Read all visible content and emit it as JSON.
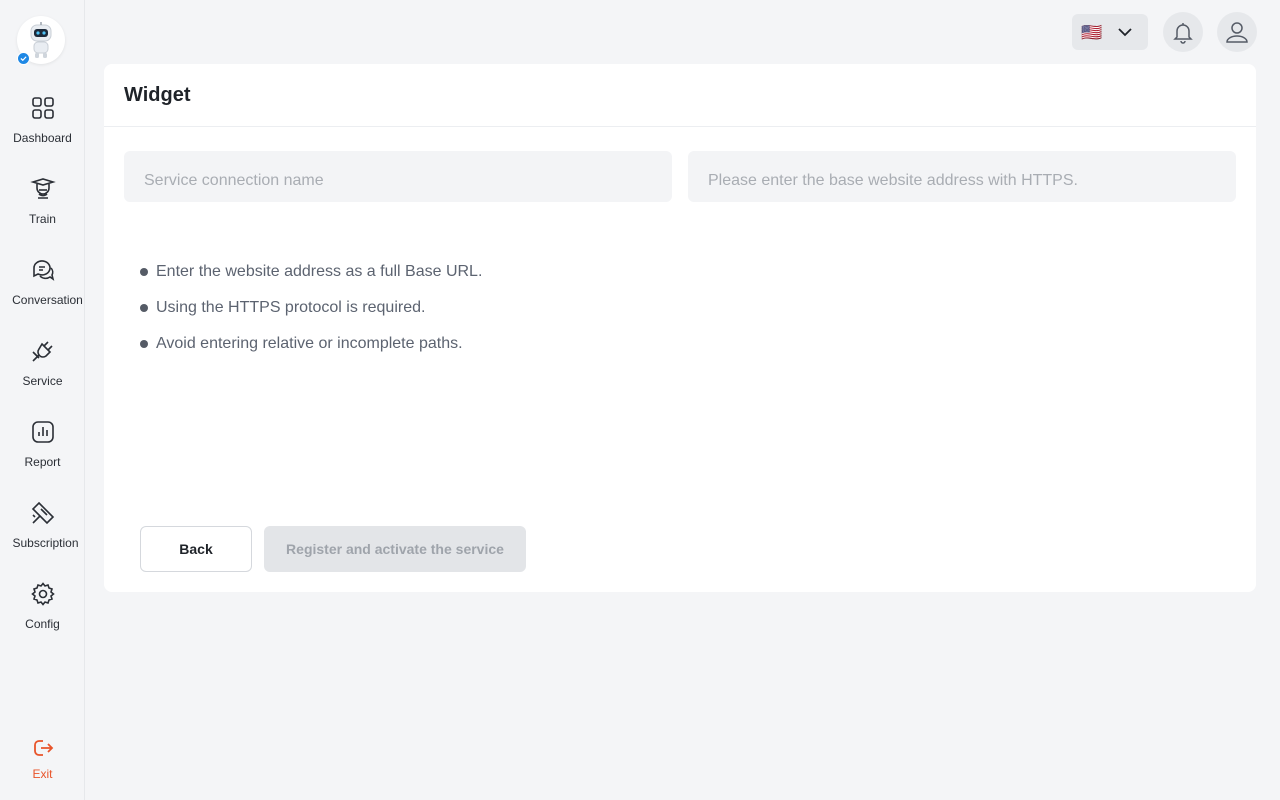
{
  "sidebar": {
    "items": [
      {
        "label": "Dashboard",
        "icon": "dashboard-icon"
      },
      {
        "label": "Train",
        "icon": "graduation-icon"
      },
      {
        "label": "Conversation",
        "icon": "chat-icon"
      },
      {
        "label": "Service",
        "icon": "plug-icon"
      },
      {
        "label": "Report",
        "icon": "report-icon"
      },
      {
        "label": "Subscription",
        "icon": "ticket-icon"
      },
      {
        "label": "Config",
        "icon": "gear-icon"
      }
    ],
    "exit_label": "Exit"
  },
  "header": {
    "language_flag": "🇺🇸"
  },
  "card": {
    "title": "Widget",
    "name_input": {
      "value": "",
      "placeholder": "Service connection name"
    },
    "url_input": {
      "value": "",
      "placeholder": "Please enter the base website address with HTTPS."
    },
    "hints": [
      "Enter the website address as a full Base URL.",
      "Using the HTTPS protocol is required.",
      "Avoid entering relative or incomplete paths."
    ],
    "back_label": "Back",
    "register_label": "Register and activate the service"
  },
  "colors": {
    "accent_exit": "#e8542a",
    "badge": "#1e88e5",
    "background": "#f4f5f7"
  }
}
